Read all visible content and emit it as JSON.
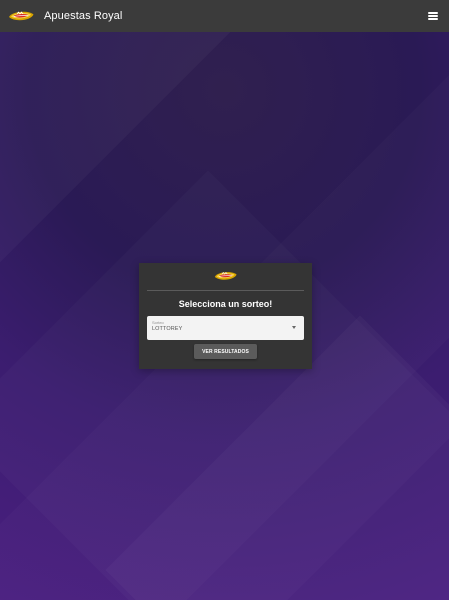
{
  "header": {
    "title": "Apuestas Royal",
    "brand_icon": "royal-logo-icon",
    "menu_icon": "menu-icon"
  },
  "card": {
    "title": "Selecciona un sorteo!",
    "logo_icon": "royal-logo-icon",
    "field": {
      "label": "Sorteo",
      "value": "LOTTOREY"
    },
    "button_label": "VER RESULTADOS"
  },
  "colors": {
    "header_bg": "#3b3b3b",
    "card_bg": "#343434",
    "button_bg": "#5b5b5b",
    "background_primary": "#2b1a52",
    "background_secondary": "#4a1f80",
    "select_bg": "#f3f3f3"
  }
}
